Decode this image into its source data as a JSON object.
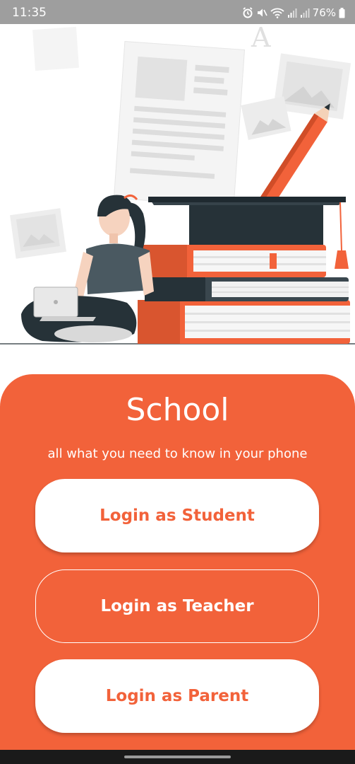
{
  "status_bar": {
    "time": "11:35",
    "battery": "76%",
    "icons": [
      "alarm-icon",
      "mute-icon",
      "wifi-icon",
      "signal-icon",
      "signal-icon",
      "battery-icon"
    ]
  },
  "illustration": {
    "watermark": "A"
  },
  "hero": {
    "title": "School",
    "subtitle": "all what you need to know in your phone"
  },
  "buttons": {
    "student": "Login as Student",
    "teacher": "Login as Teacher",
    "parent": "Login as Parent"
  },
  "colors": {
    "accent": "#f2623a",
    "status_bar": "#9e9e9e",
    "nav_bar": "#1a1a1a",
    "dark": "#263238"
  }
}
